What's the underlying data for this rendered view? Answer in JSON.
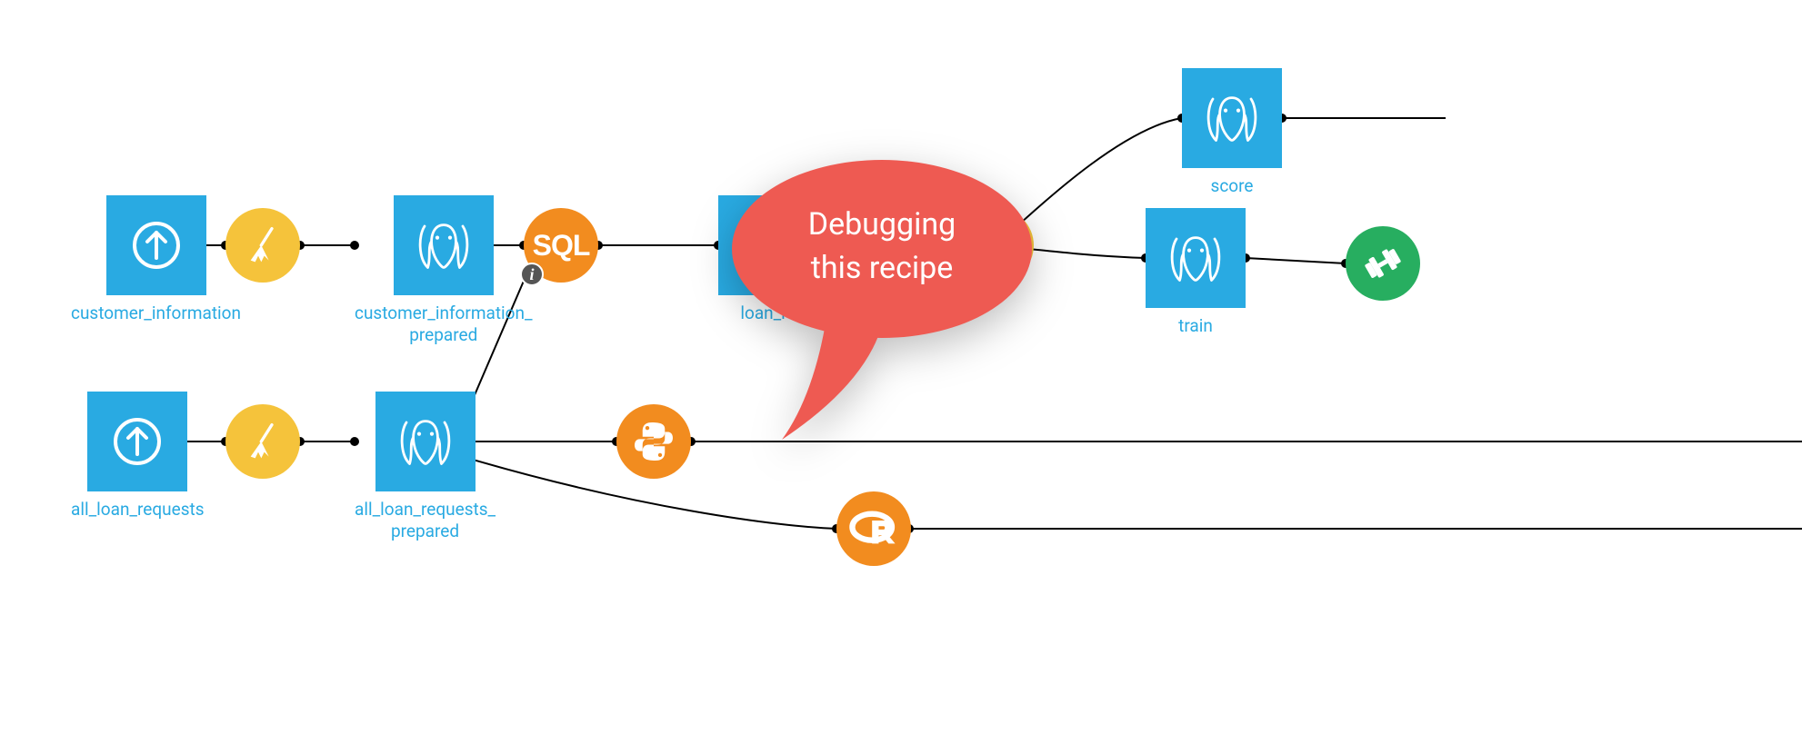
{
  "nodes": {
    "customer_information": {
      "label": "customer_information"
    },
    "customer_information_prepared": {
      "label": "customer_information_\nprepared"
    },
    "all_loan_requests": {
      "label": "all_loan_requests"
    },
    "all_loan_requests_prepared": {
      "label": "all_loan_requests_\nprepared"
    },
    "loan_requests_joined": {
      "label": "loan_re"
    },
    "score": {
      "label": "score"
    },
    "train": {
      "label": "train"
    }
  },
  "recipes": {
    "prep1": {
      "type": "prepare",
      "icon": "broom"
    },
    "prep2": {
      "type": "prepare",
      "icon": "broom"
    },
    "sql": {
      "type": "sql",
      "label": "SQL"
    },
    "python": {
      "type": "python",
      "icon": "python"
    },
    "r": {
      "type": "r",
      "icon": "r"
    },
    "split": {
      "type": "split"
    },
    "model": {
      "type": "model",
      "icon": "dumbbell"
    }
  },
  "callout": {
    "line1": "Debugging",
    "line2": "this recipe"
  },
  "colors": {
    "dataset": "#29AAE2",
    "recipe_orange": "#F28C1F",
    "recipe_yellow": "#F5C33B",
    "recipe_green": "#27AE60",
    "callout": "#EE5A52"
  }
}
